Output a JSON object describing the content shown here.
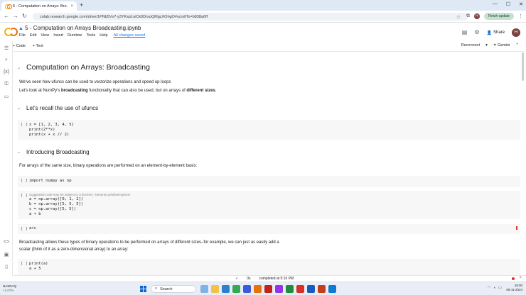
{
  "browser": {
    "tab_title": "5 - Computation on Arrays: Bro...",
    "tab_close": "×",
    "new_tab": "+",
    "win_min": "—",
    "win_max": "☐",
    "win_close": "✕",
    "back": "←",
    "forward": "→",
    "reload": "↻",
    "url": "colab.research.google.com/drive/1PNb5Vv7-y3YKsp1oiCk0DrsuQMgzXOhgO#scrollTo=b838a0ff",
    "finish_update": "Finish update"
  },
  "colab": {
    "drive_icon": "▲",
    "title": "5 - Computation on Arrays Broadcasting.ipynb",
    "menus": [
      "File",
      "Edit",
      "View",
      "Insert",
      "Runtime",
      "Tools",
      "Help"
    ],
    "saved": "All changes saved",
    "share": "Share",
    "avatar": "H",
    "toolbar": {
      "add_code": "+ Code",
      "add_text": "+ Text",
      "reconnect": "Reconnect",
      "gemini": "Gemini"
    }
  },
  "notebook": {
    "heading1": "Computation on Arrays: Broadcasting",
    "intro1": "We've seen how ufuncs can be used to vectorize operations and speed up loops",
    "intro2_a": "Let's look at NumPy's ",
    "intro2_b": "broadcasting",
    "intro2_c": " functionality that can also be used, but on arrays of ",
    "intro2_d": "different sizes",
    "intro2_e": ".",
    "heading2a": "Let's recall the use of ufuncs",
    "run_icon": "[ ]",
    "cell1": [
      "x = [1, 2, 3, 4, 5]",
      "print(2**x)",
      "print(x + x // 2)"
    ],
    "heading2b": "Introducing Broadcasting",
    "para_same_size": "For arrays of the same size, binary operations are performed on an element-by-element basis:",
    "cell2": "import numpy as np",
    "cell3_hint": "Suggested code may be subject to a license | SuleaneLiu/MDIeexplorer",
    "cell3": [
      "a = np.array([0, 1, 2])",
      "b = np.array([5, 5, 5])",
      "c = np.array([5, 5])",
      "a + b"
    ],
    "cell4": "a+c",
    "para_broadcast_1": "Broadcasting allows these types of binary operations to be performed on arrays of different sizes–for example, we can just as easily add a",
    "para_broadcast_2": "scalar (think of it as a zero-dimensional array) to an array:",
    "cell5": [
      "print(a)",
      "a + 5"
    ]
  },
  "status": {
    "check": "✓",
    "elapsed": "0s",
    "completed": "completed at 5:10 PM"
  },
  "taskbar": {
    "ticker_name": "NASDAQ",
    "ticker_change": "+1.07%",
    "search": "Search",
    "time": "18:00",
    "date": "05-11-2024"
  }
}
